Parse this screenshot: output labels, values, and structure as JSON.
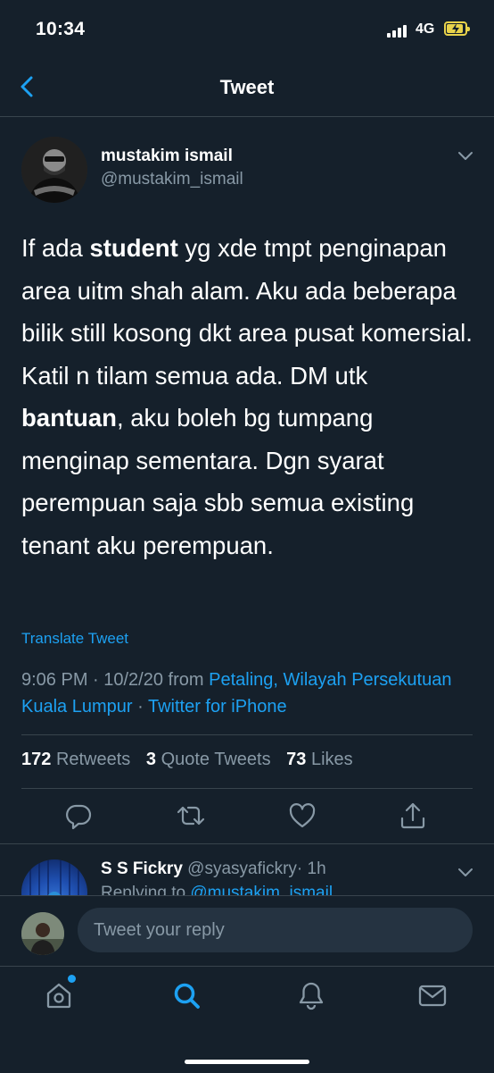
{
  "status_bar": {
    "time": "10:34",
    "network": "4G",
    "battery_icon": "battery-charging-icon"
  },
  "nav": {
    "title": "Tweet",
    "back_icon": "chevron-left-icon"
  },
  "tweet": {
    "author_name": "mustakim ismail",
    "author_handle": "@mustakim_ismail",
    "text_segments": [
      "If ada ",
      "student",
      " yg xde tmpt penginapan area uitm shah alam. Aku ada beberapa bilik still kosong dkt area pusat komersial. Katil n tilam semua ada. DM utk ",
      "bantuan",
      ", aku boleh bg tumpang menginap sementara. Dgn syarat perempuan saja sbb semua existing tenant aku perempuan."
    ],
    "translate_label": "Translate Tweet",
    "time": "9:06 PM · 10/2/20 from ",
    "location": "Petaling, Wilayah Persekutuan Kuala Lumpur",
    "separator": " · ",
    "source": "Twitter for iPhone",
    "stats": {
      "retweets_count": "172",
      "retweets_label": "Retweets",
      "quotes_count": "3",
      "quotes_label": "Quote Tweets",
      "likes_count": "73",
      "likes_label": "Likes"
    },
    "actions": [
      "reply-icon",
      "retweet-icon",
      "like-icon",
      "share-icon"
    ]
  },
  "reply": {
    "name": "S S Fickry",
    "handle": "@syasyafickry",
    "time": "· 1h",
    "replying_prefix": "Replying to ",
    "replying_handle": "@mustakim_ismail"
  },
  "composer": {
    "placeholder": "Tweet your reply"
  },
  "tabbar": {
    "items": [
      "home-icon",
      "search-icon",
      "notifications-icon",
      "messages-icon"
    ],
    "active": "search-icon"
  },
  "colors": {
    "background": "#15202b",
    "accent": "#1da1f2",
    "secondary_text": "#8899a6",
    "divider": "#38444d"
  }
}
